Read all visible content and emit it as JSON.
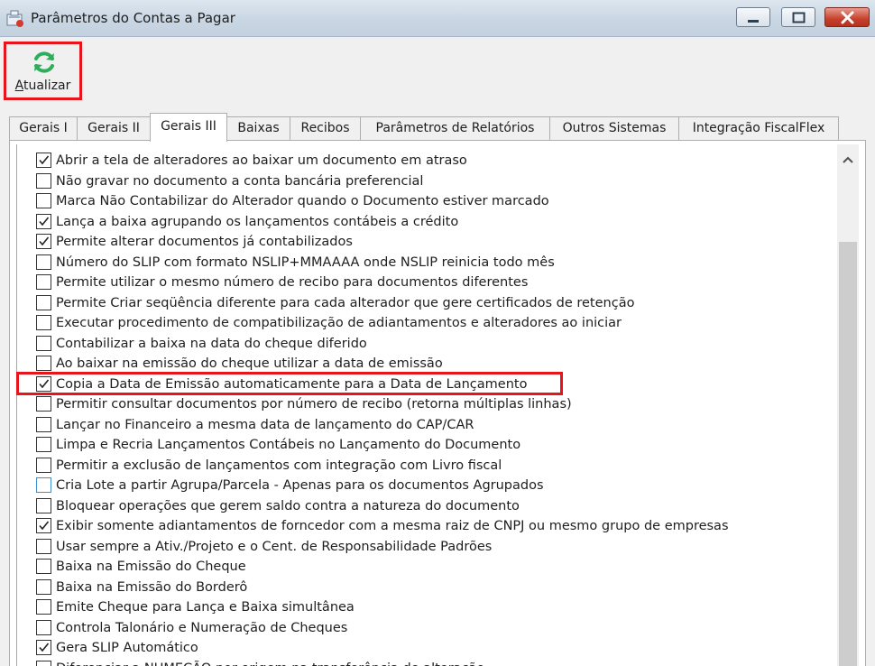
{
  "window": {
    "title": "Parâmetros do Contas a Pagar",
    "accent_highlight": "#e8141c"
  },
  "toolbar": {
    "refresh_label_accel": "A",
    "refresh_label_rest": "tualizar",
    "refresh_icon": "refresh-icon"
  },
  "tabs": [
    {
      "label": "Gerais I",
      "active": false
    },
    {
      "label": "Gerais II",
      "active": false
    },
    {
      "label": "Gerais III",
      "active": true
    },
    {
      "label": "Baixas",
      "active": false
    },
    {
      "label": "Recibos",
      "active": false
    },
    {
      "label": "Parâmetros de Relatórios",
      "active": false
    },
    {
      "label": "Outros Sistemas",
      "active": false
    },
    {
      "label": "Integração FiscalFlex",
      "active": false
    }
  ],
  "options": [
    {
      "label": "Abrir a tela de alteradores ao baixar um documento em atraso",
      "checked": true
    },
    {
      "label": "Não gravar no documento a conta bancária preferencial",
      "checked": false
    },
    {
      "label": "Marca Não Contabilizar do Alterador quando o Documento estiver marcado",
      "checked": false
    },
    {
      "label": "Lança a baixa agrupando os lançamentos contábeis a crédito",
      "checked": true
    },
    {
      "label": "Permite alterar documentos já contabilizados",
      "checked": true
    },
    {
      "label": "Número do SLIP com formato NSLIP+MMAAAA onde NSLIP reinicia todo mês",
      "checked": false
    },
    {
      "label": "Permite utilizar o mesmo número de recibo para documentos diferentes",
      "checked": false
    },
    {
      "label": "Permite Criar seqüência diferente para cada alterador que gere certificados de retenção",
      "checked": false
    },
    {
      "label": "Executar procedimento de compatibilização de adiantamentos e alteradores ao iniciar",
      "checked": false
    },
    {
      "label": "Contabilizar a baixa na data do cheque diferido",
      "checked": false
    },
    {
      "label": "Ao baixar na emissão do cheque utilizar a data de emissão",
      "checked": false
    },
    {
      "label": "Copia a Data de Emissão automaticamente para a Data de Lançamento",
      "checked": true
    },
    {
      "label": "Permitir consultar documentos por número de recibo (retorna múltiplas linhas)",
      "checked": false
    },
    {
      "label": "Lançar no Financeiro a mesma data de lançamento do CAP/CAR",
      "checked": false
    },
    {
      "label": "Limpa e Recria Lançamentos Contábeis no Lançamento do Documento",
      "checked": false
    },
    {
      "label": "Permitir a exclusão de lançamentos com integração com Livro fiscal",
      "checked": false
    },
    {
      "label": "Cria Lote a partir Agrupa/Parcela - Apenas para os documentos Agrupados",
      "checked": false
    },
    {
      "label": "Bloquear operações que gerem saldo contra a natureza do documento",
      "checked": false
    },
    {
      "label": "Exibir somente adiantamentos de forncedor com a mesma raiz de CNPJ ou mesmo grupo de empresas",
      "checked": true
    },
    {
      "label": "Usar sempre a Ativ./Projeto e o Cent. de Responsabilidade Padrões",
      "checked": false
    },
    {
      "label": "Baixa na Emissão do Cheque",
      "checked": false
    },
    {
      "label": "Baixa na Emissão do Borderô",
      "checked": false
    },
    {
      "label": "Emite Cheque para Lança e Baixa simultânea",
      "checked": false
    },
    {
      "label": "Controla Talonário e Numeração de Cheques",
      "checked": false
    },
    {
      "label": "Gera SLIP Automático",
      "checked": true
    },
    {
      "label": "Diferenciar a NUMEÇÃO por origem na transferência de alteração",
      "checked": false
    }
  ]
}
